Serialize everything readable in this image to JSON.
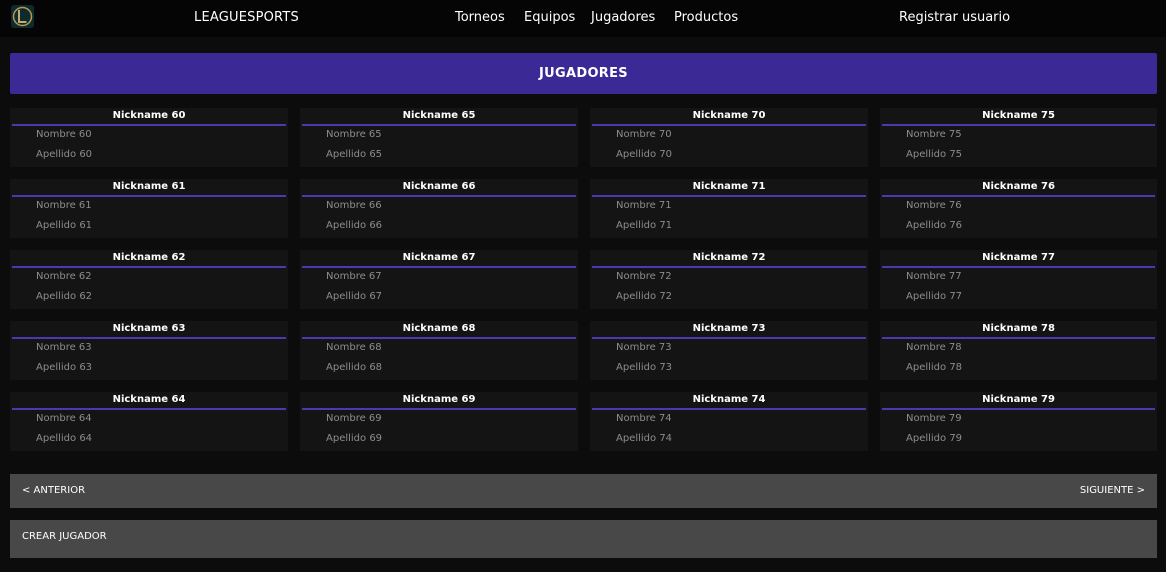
{
  "navbar": {
    "brand": "LEAGUESPORTS",
    "links": [
      "Torneos",
      "Equipos",
      "Jugadores",
      "Productos"
    ],
    "register": "Registrar usuario"
  },
  "banner": {
    "title": "JUGADORES"
  },
  "players": [
    {
      "nickname": "Nickname 60",
      "nombre": "Nombre 60",
      "apellido": "Apellido 60"
    },
    {
      "nickname": "Nickname 61",
      "nombre": "Nombre 61",
      "apellido": "Apellido 61"
    },
    {
      "nickname": "Nickname 62",
      "nombre": "Nombre 62",
      "apellido": "Apellido 62"
    },
    {
      "nickname": "Nickname 63",
      "nombre": "Nombre 63",
      "apellido": "Apellido 63"
    },
    {
      "nickname": "Nickname 64",
      "nombre": "Nombre 64",
      "apellido": "Apellido 64"
    },
    {
      "nickname": "Nickname 65",
      "nombre": "Nombre 65",
      "apellido": "Apellido 65"
    },
    {
      "nickname": "Nickname 66",
      "nombre": "Nombre 66",
      "apellido": "Apellido 66"
    },
    {
      "nickname": "Nickname 67",
      "nombre": "Nombre 67",
      "apellido": "Apellido 67"
    },
    {
      "nickname": "Nickname 68",
      "nombre": "Nombre 68",
      "apellido": "Apellido 68"
    },
    {
      "nickname": "Nickname 69",
      "nombre": "Nombre 69",
      "apellido": "Apellido 69"
    },
    {
      "nickname": "Nickname 70",
      "nombre": "Nombre 70",
      "apellido": "Apellido 70"
    },
    {
      "nickname": "Nickname 71",
      "nombre": "Nombre 71",
      "apellido": "Apellido 71"
    },
    {
      "nickname": "Nickname 72",
      "nombre": "Nombre 72",
      "apellido": "Apellido 72"
    },
    {
      "nickname": "Nickname 73",
      "nombre": "Nombre 73",
      "apellido": "Apellido 73"
    },
    {
      "nickname": "Nickname 74",
      "nombre": "Nombre 74",
      "apellido": "Apellido 74"
    },
    {
      "nickname": "Nickname 75",
      "nombre": "Nombre 75",
      "apellido": "Apellido 75"
    },
    {
      "nickname": "Nickname 76",
      "nombre": "Nombre 76",
      "apellido": "Apellido 76"
    },
    {
      "nickname": "Nickname 77",
      "nombre": "Nombre 77",
      "apellido": "Apellido 77"
    },
    {
      "nickname": "Nickname 78",
      "nombre": "Nombre 78",
      "apellido": "Apellido 78"
    },
    {
      "nickname": "Nickname 79",
      "nombre": "Nombre 79",
      "apellido": "Apellido 79"
    }
  ],
  "pager": {
    "prev": "< ANTERIOR",
    "next": "SIGUIENTE >"
  },
  "actions": {
    "create": "CREAR JUGADOR"
  },
  "colors": {
    "accent": "#3b2a96",
    "divider": "#4b39b0",
    "background": "#0c0c0c"
  },
  "icons": {
    "logo": "league-logo-icon"
  }
}
